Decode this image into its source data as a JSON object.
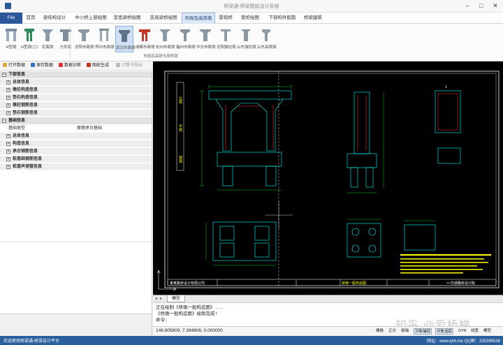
{
  "window": {
    "title": "桥梁通-桥梁图纸设计系统"
  },
  "menu": {
    "items": [
      "File",
      "首页",
      "梁结构设计",
      "中小桥上部绘图",
      "变宽梁桥绘图",
      "变高梁桥绘图",
      "市政及高铁墩",
      "景观桥",
      "管桩绘图",
      "下部构件配筋",
      "桥梁建筑"
    ],
    "active_index": 6
  },
  "ribbon": {
    "buttons": [
      {
        "label": "H型墩",
        "icon": "h-pier-icon"
      },
      {
        "label": "H型墩(二)",
        "icon": "h-pier-2-icon"
      },
      {
        "label": "花瓶墩",
        "icon": "vase-pier-icon"
      },
      {
        "label": "方形墩",
        "icon": "square-pier-icon"
      },
      {
        "label": "沈阳市政墩",
        "icon": "shenyang-pier-icon"
      },
      {
        "label": "郑州市政墩",
        "icon": "zhengzhou-pier-icon"
      },
      {
        "label": "武汉市政墩",
        "icon": "wuhan-pier-icon",
        "selected": true
      },
      {
        "label": "成都市政墩",
        "icon": "chengdu-pier-icon"
      },
      {
        "label": "杭州市政墩",
        "icon": "hangzhou-pier-icon"
      },
      {
        "label": "福州市政墩",
        "icon": "fuzhou-pier-icon"
      },
      {
        "label": "中交市政墩",
        "icon": "zhongjiao-pier-icon"
      },
      {
        "label": "沈阳独柱墩",
        "icon": "shenyang-single-pier-icon"
      },
      {
        "label": "山东独柱墩",
        "icon": "shandong-single-pier-icon"
      },
      {
        "label": "山东高铁墩",
        "icon": "shandong-hsr-pier-icon"
      }
    ],
    "group_label": "市政及高铁专用桥墩"
  },
  "toolbar": {
    "open": "打开数据",
    "save": "保存数据",
    "diagnose": "数据诊断",
    "generate": "图纸生成",
    "export": "计算书导出"
  },
  "property_panel": {
    "sections": [
      {
        "title": "下部信息",
        "items": [
          "总体信息",
          "墩柱构造信息",
          "垫石构造信息",
          "墩柱钢筋信息",
          "垫石钢筋信息"
        ]
      },
      {
        "title": "基础信息",
        "kv_label": "基础类型",
        "kv_value": "摩擦承台基础",
        "items": [
          "总体信息",
          "构造信息",
          "承台钢筋信息",
          "桩基础钢筋信息",
          "桩基声测管信息"
        ]
      }
    ]
  },
  "drawing": {
    "labels": {
      "side_label_1": "立面",
      "side_label_2": "平面",
      "side_label_3": "侧面"
    },
    "title_block": {
      "company": "某某路桥设计有限公司",
      "drawing_name": "桥墩一般构造图",
      "project": "××交通路桥设计院"
    }
  },
  "model_tab": "模型",
  "command": {
    "lines": [
      "正在绘制《桥墩一般构造图》...",
      "《桥墩一般构造图》绘制完成!",
      "命令:"
    ]
  },
  "watermark": "知乎 @爱桥梯",
  "status": {
    "coords": "146.905809, 7.394806, 0.000000",
    "toggles": [
      {
        "label": "栅格",
        "on": false
      },
      {
        "label": "正交",
        "on": false
      },
      {
        "label": "极轴",
        "on": false
      },
      {
        "label": "对象捕捉",
        "on": true
      },
      {
        "label": "对象追踪",
        "on": true
      },
      {
        "label": "DYN",
        "on": false
      },
      {
        "label": "线宽",
        "on": false
      },
      {
        "label": "模型",
        "on": false
      }
    ]
  },
  "bottom": {
    "message": "欢迎使用桥梁通-桥梁设计平台",
    "contact": "网址：www.qhit.me QQ群：235399538"
  },
  "colors": {
    "accent": "#2b579a",
    "cad_yellow": "#ffff00",
    "cad_cyan": "#00ffff",
    "cad_green": "#00ff00",
    "cad_red": "#ff3030",
    "cad_white": "#ffffff"
  }
}
